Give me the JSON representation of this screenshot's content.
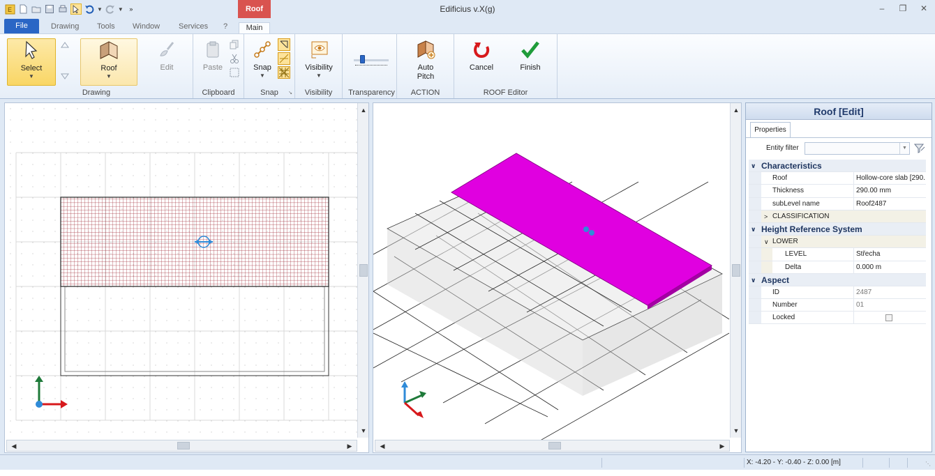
{
  "app": {
    "title": "Edificius v.X(g)"
  },
  "ribbon": {
    "context_tab": "Roof",
    "tabs": [
      "Drawing",
      "Tools",
      "Window",
      "Services",
      "?"
    ],
    "file_tab": "File",
    "main_tab": "Main",
    "groups": {
      "drawing": {
        "caption": "Drawing",
        "select": "Select",
        "roof": "Roof",
        "edit": "Edit"
      },
      "clipboard": {
        "caption": "Clipboard",
        "paste": "Paste"
      },
      "snap": {
        "caption": "Snap",
        "snap": "Snap"
      },
      "visibility": {
        "caption": "Visibility",
        "visibility": "Visibility"
      },
      "transparency": {
        "caption": "Transparency",
        "level": 0.2
      },
      "action": {
        "caption": "ACTION",
        "auto_pitch": "Auto Pitch"
      },
      "roof_editor": {
        "caption": "ROOF Editor",
        "cancel": "Cancel",
        "finish": "Finish"
      }
    }
  },
  "panel": {
    "title": "Roof [Edit]",
    "tab": "Properties",
    "filter_label": "Entity filter",
    "filter_value": "",
    "rows": {
      "characteristics": "Characteristics",
      "roof_k": "Roof",
      "roof_v": "Hollow-core slab [290.",
      "thickness_k": "Thickness",
      "thickness_v": "290.00 mm",
      "sublevel_k": "subLevel name",
      "sublevel_v": "Roof2487",
      "classification": "CLASSIFICATION",
      "height_ref": "Height Reference System",
      "lower": "LOWER",
      "level_k": "LEVEL",
      "level_v": "Střecha",
      "delta_k": "Delta",
      "delta_v": "0.000 m",
      "aspect": "Aspect",
      "id_k": "ID",
      "id_v": "2487",
      "number_k": "Number",
      "number_v": "01",
      "locked_k": "Locked",
      "locked_v": false
    }
  },
  "status": {
    "coords": "X: -4.20 - Y: -0.40 - Z: 0.00 [m]"
  },
  "colors": {
    "accent": "#2a66c5",
    "roof_highlight": "#e000e0",
    "plan_hatch": "#a3303b"
  }
}
